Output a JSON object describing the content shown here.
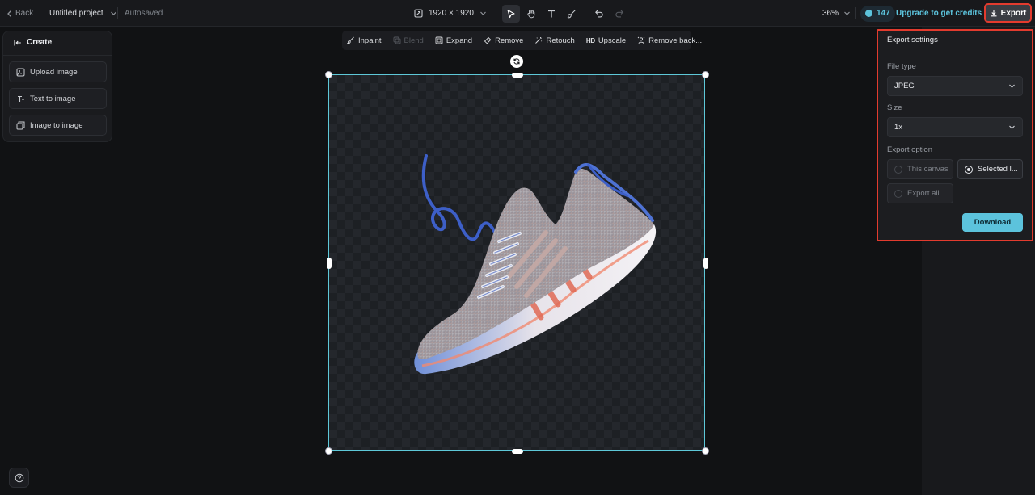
{
  "header": {
    "back_label": "Back",
    "project_name": "Untitled project",
    "save_status": "Autosaved",
    "canvas_size": "1920 × 1920",
    "zoom": "36%",
    "credits": "147",
    "upgrade_label": "Upgrade to get credits",
    "export_label": "Export"
  },
  "create_panel": {
    "title": "Create",
    "items": [
      {
        "label": "Upload image",
        "icon": "upload-image-icon"
      },
      {
        "label": "Text to image",
        "icon": "text-to-image-icon"
      },
      {
        "label": "Image to image",
        "icon": "image-to-image-icon"
      }
    ]
  },
  "image_toolbar": {
    "items": [
      {
        "label": "Inpaint",
        "enabled": true
      },
      {
        "label": "Blend",
        "enabled": false
      },
      {
        "label": "Expand",
        "enabled": true
      },
      {
        "label": "Remove",
        "enabled": true
      },
      {
        "label": "Retouch",
        "enabled": true
      },
      {
        "label": "Upscale",
        "enabled": true,
        "badge": "HD"
      },
      {
        "label": "Remove back...",
        "enabled": true
      }
    ]
  },
  "export_settings": {
    "title": "Export settings",
    "file_type_label": "File type",
    "file_type_value": "JPEG",
    "size_label": "Size",
    "size_value": "1x",
    "export_option_label": "Export option",
    "options": [
      {
        "label": "This canvas",
        "selected": false
      },
      {
        "label": "Selected l...",
        "selected": true
      },
      {
        "label": "Export all ...",
        "selected": false
      }
    ],
    "download_label": "Download"
  },
  "colors": {
    "accent": "#5cc3dc",
    "highlight_box": "#e23b2e",
    "background": "#111214"
  }
}
